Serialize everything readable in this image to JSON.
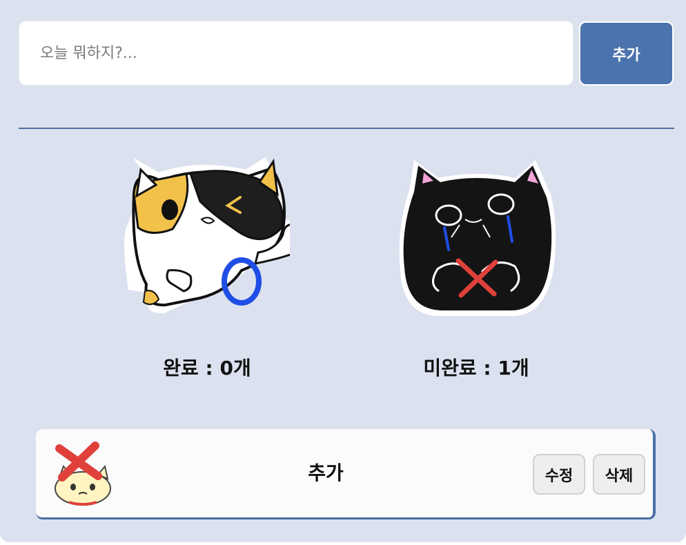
{
  "input": {
    "placeholder": "오늘 뭐하지?..."
  },
  "add_button": {
    "label": "추가"
  },
  "stats": {
    "done_label": "완료 : 0개",
    "undone_label": "미완료 : 1개"
  },
  "todos": [
    {
      "text": "추가",
      "status_icon": "cat-cross-icon",
      "edit_label": "수정",
      "delete_label": "삭제"
    }
  ],
  "colors": {
    "background": "#dbe1ee",
    "accent": "#4b73ad",
    "divider": "#4f6f9c",
    "check_blue": "#1f4ee6",
    "cross_red": "#e0403a"
  }
}
